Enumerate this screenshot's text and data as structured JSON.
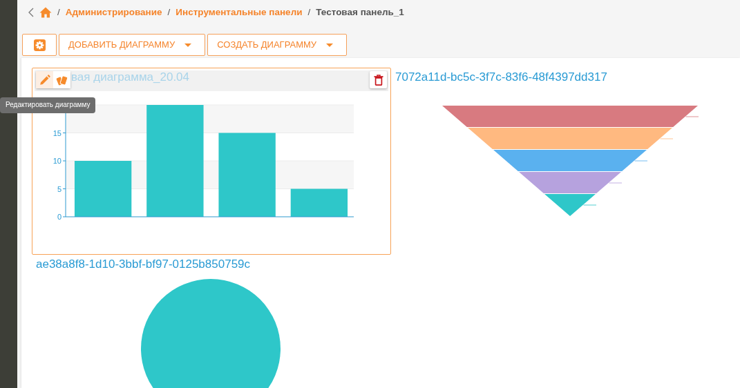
{
  "breadcrumb": [
    {
      "separator": "/",
      "label": "Администрирование",
      "kind": "link"
    },
    {
      "separator": "/",
      "label": "Инструментальные панели",
      "kind": "link"
    },
    {
      "separator": "/",
      "label": "Тестовая панель_1",
      "kind": "current"
    }
  ],
  "toolbar": [
    {
      "kind": "settings"
    },
    {
      "kind": "dropdown",
      "label": "ДОБАВИТЬ ДИАГРАММУ"
    },
    {
      "kind": "dropdown",
      "label": "СОЗДАТЬ ДИАГРАММУ"
    }
  ],
  "widgets": [
    {
      "kind": "bar",
      "title": "вая диаграмма_20.04",
      "highlighted": true,
      "actions": [
        {
          "kind": "edit",
          "hovered": true
        },
        {
          "kind": "style",
          "hovered": false
        },
        {
          "kind": "delete",
          "hovered": false
        }
      ],
      "chart_data": {
        "type": "bar",
        "values": [
          10,
          20,
          15,
          5
        ],
        "ylim": [
          0,
          20
        ],
        "yticks": [
          0,
          5,
          10,
          15
        ],
        "grid": true
      }
    },
    {
      "kind": "funnel",
      "title": "7072a11d-bc5c-3f7c-83f6-48f4397dd317",
      "highlighted": false,
      "segments": [
        {
          "color": "#d87a80"
        },
        {
          "color": "#ffb980"
        },
        {
          "color": "#5ab1ef"
        },
        {
          "color": "#b6a2de"
        },
        {
          "color": "#2ec7c9"
        }
      ]
    },
    {
      "kind": "pie",
      "title": "ae38a8f8-1d10-3bbf-bf97-0125b850759c",
      "highlighted": false
    }
  ],
  "tooltip": {
    "text": "Редактировать диаграмму"
  }
}
